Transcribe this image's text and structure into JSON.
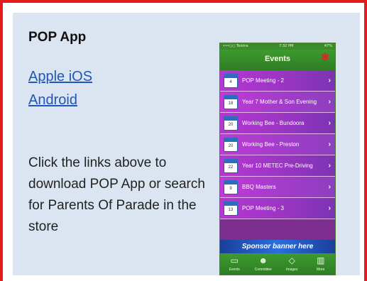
{
  "title": "POP App",
  "links": {
    "ios": "Apple iOS",
    "android": "Android"
  },
  "description": "Click the links above to download POP App or search for Parents Of Parade in the store",
  "phone": {
    "status": {
      "carrier": "•••○○ Telstra",
      "time": "7:32 PM",
      "battery": "47%"
    },
    "header_title": "Events",
    "events": [
      {
        "label": "POP Meeting - 2",
        "day": "4"
      },
      {
        "label": "Year 7 Mother & Son Evening",
        "day": "18"
      },
      {
        "label": "Working Bee - Bundoora",
        "day": "20"
      },
      {
        "label": "Working Bee - Preston",
        "day": "20"
      },
      {
        "label": "Year 10 METEC Pre-Driving",
        "day": "22"
      },
      {
        "label": "BBQ Masters",
        "day": "9"
      },
      {
        "label": "POP Meeting - 3",
        "day": "13"
      }
    ],
    "banner": "Sponsor banner here",
    "tabs": [
      {
        "label": "Events",
        "icon": "calendar-icon"
      },
      {
        "label": "Committee",
        "icon": "people-icon"
      },
      {
        "label": "Images",
        "icon": "images-icon"
      },
      {
        "label": "More",
        "icon": "more-icon"
      }
    ]
  },
  "colors": {
    "border": "#e21b1b",
    "panel": "#dbe5f1",
    "link": "#1f56b7",
    "app_green": "#3d9b2f",
    "app_purple": "#a23cc9"
  }
}
